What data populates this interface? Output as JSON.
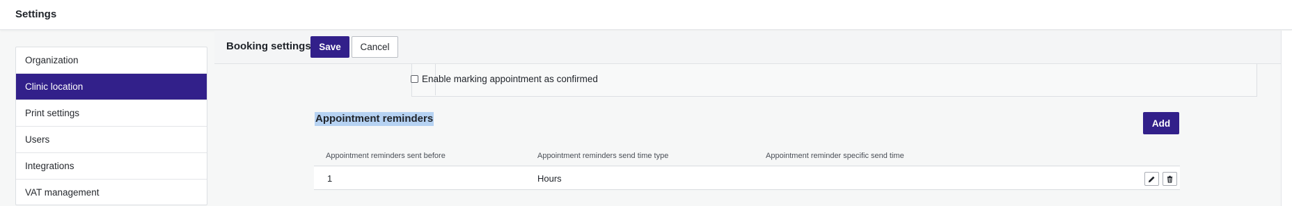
{
  "app": {
    "title": "Settings"
  },
  "sidebar": {
    "items": [
      {
        "label": "Organization"
      },
      {
        "label": "Clinic location"
      },
      {
        "label": "Print settings"
      },
      {
        "label": "Users"
      },
      {
        "label": "Integrations"
      },
      {
        "label": "VAT management"
      }
    ],
    "active_index": 1
  },
  "header": {
    "title": "Booking settings",
    "save_label": "Save",
    "cancel_label": "Cancel"
  },
  "form": {
    "confirm_label": "Enable marking appointment as confirmed",
    "confirm_checked": false
  },
  "reminders": {
    "title": "Appointment reminders",
    "add_label": "Add",
    "columns": [
      "Appointment reminders sent before",
      "Appointment reminders send time type",
      "Appointment reminder specific send time"
    ],
    "rows": [
      {
        "sent_before": "1",
        "time_type": "Hours",
        "specific_time": ""
      }
    ]
  },
  "colors": {
    "accent": "#32208a",
    "selection": "#b6d2f2"
  },
  "icons": {
    "edit": "pencil-icon",
    "delete": "trash-icon"
  }
}
